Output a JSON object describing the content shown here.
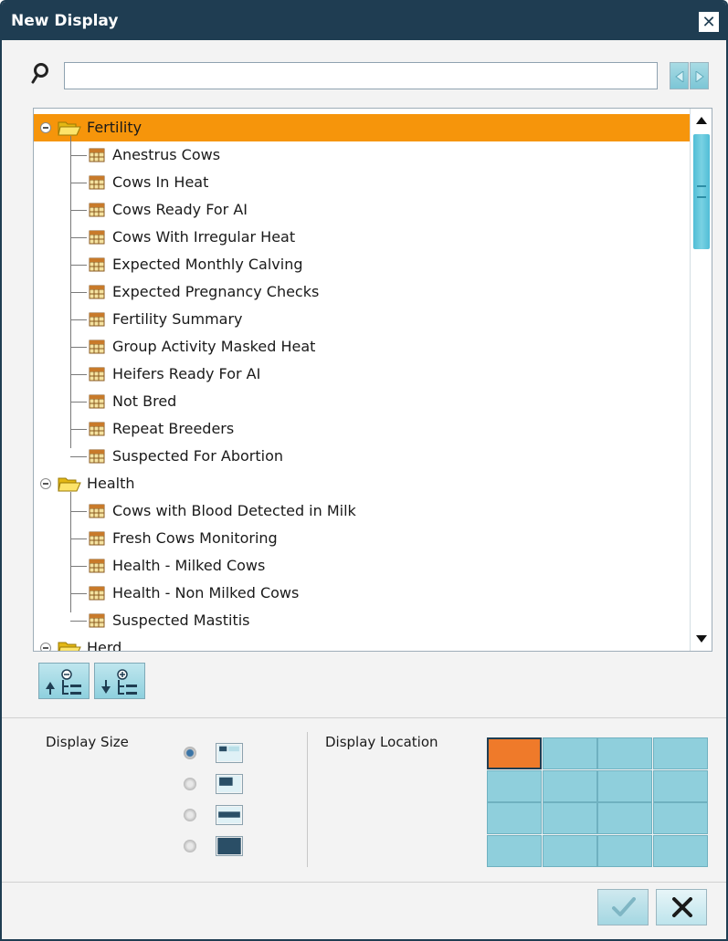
{
  "window": {
    "title": "New Display",
    "close_glyph": "✕"
  },
  "search": {
    "value": "",
    "placeholder": ""
  },
  "tree": {
    "groups": [
      {
        "label": "Fertility",
        "expanded": true,
        "selected": true,
        "items": [
          "Anestrus Cows",
          "Cows In Heat",
          "Cows Ready For AI",
          "Cows With Irregular Heat",
          "Expected Monthly Calving",
          "Expected Pregnancy Checks",
          "Fertility Summary",
          "Group Activity Masked Heat",
          "Heifers Ready For AI",
          "Not Bred",
          "Repeat Breeders",
          "Suspected For Abortion"
        ]
      },
      {
        "label": "Health",
        "expanded": true,
        "selected": false,
        "items": [
          "Cows with Blood Detected in Milk",
          "Fresh Cows Monitoring",
          "Health - Milked Cows",
          "Health - Non Milked Cows",
          "Suspected Mastitis"
        ]
      },
      {
        "label": "Herd",
        "expanded": true,
        "selected": false,
        "items": []
      }
    ]
  },
  "display_size": {
    "label": "Display Size",
    "selected_index": 0,
    "options": [
      "small-icon",
      "medium-icon",
      "wide-icon",
      "full-icon"
    ]
  },
  "display_location": {
    "label": "Display Location",
    "rows": 4,
    "cols": 4,
    "selected_cell": [
      0,
      0
    ]
  },
  "colors": {
    "title_bar": "#1f3d52",
    "selection": "#f6950b",
    "grid_cell": "#8fcfdc",
    "grid_selected": "#ef7a2a",
    "accent": "#50bdd6"
  },
  "icons": {
    "search": "search-icon",
    "prev": "arrow-left-icon",
    "next": "arrow-right-icon",
    "ok": "checkmark-icon",
    "cancel": "x-icon"
  }
}
